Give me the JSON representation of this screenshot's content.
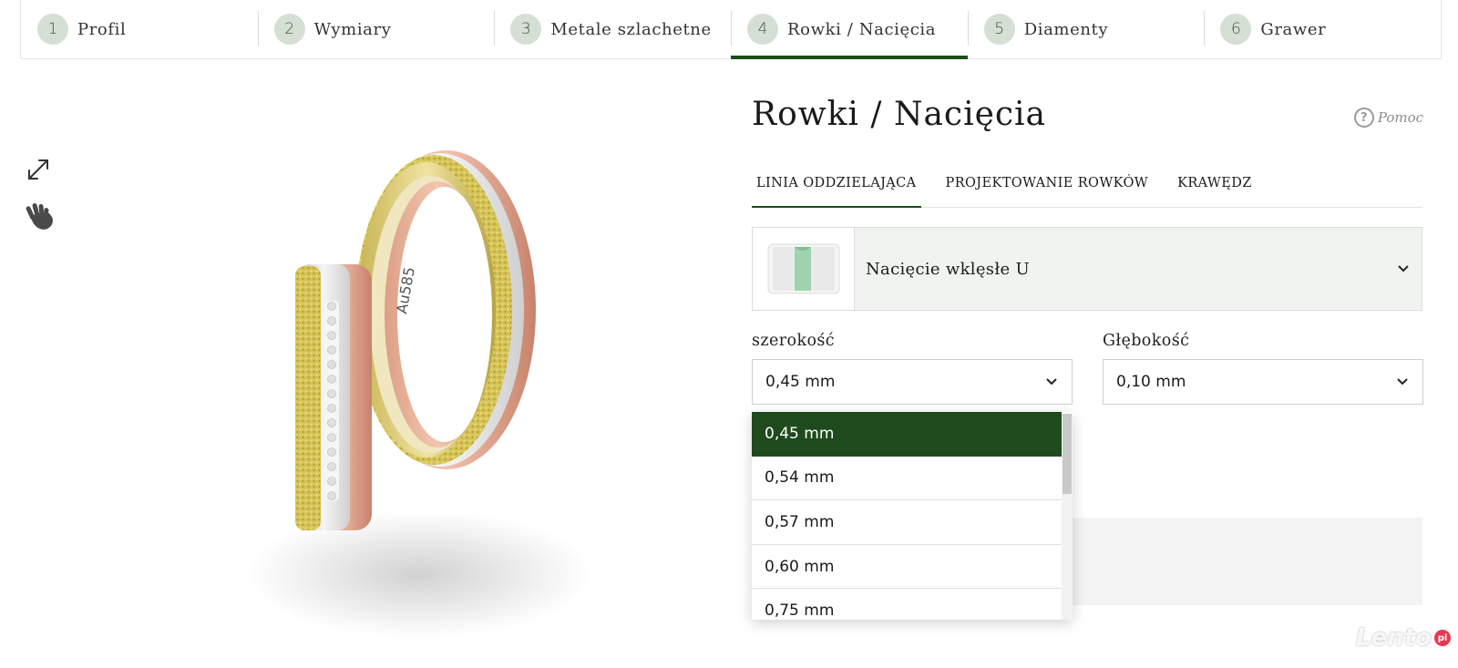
{
  "steps": [
    {
      "num": "1",
      "label": "Profil"
    },
    {
      "num": "2",
      "label": "Wymiary"
    },
    {
      "num": "3",
      "label": "Metale szlachetne"
    },
    {
      "num": "4",
      "label": "Rowki / Nacięcia"
    },
    {
      "num": "5",
      "label": "Diamenty"
    },
    {
      "num": "6",
      "label": "Grawer"
    }
  ],
  "active_step": "4",
  "tools": {
    "expand_icon": "expand-icon",
    "hand_icon": "hand-drag-icon"
  },
  "preview": {
    "engraving": "Au585"
  },
  "panel": {
    "title": "Rowki / Nacięcia",
    "help_label": "Pomoc",
    "help_glyph": "?",
    "subtabs": [
      "LINIA ODDZIELAJĄCA",
      "PROJEKTOWANIE ROWKÓW",
      "KRAWĘDZ"
    ],
    "active_subtab": "LINIA ODDZIELAJĄCA",
    "cut_type": "Nacięcie wklęsłe U",
    "width_label": "szerokość",
    "width_value": "0,45 mm",
    "depth_label": "Głębokość",
    "depth_value": "0,10 mm"
  },
  "width_options": [
    "0,45 mm",
    "0,54 mm",
    "0,57 mm",
    "0,60 mm",
    "0,75 mm"
  ],
  "width_selected": "0,45 mm",
  "watermark": {
    "text": "Lento",
    "badge": "pl"
  },
  "colors": {
    "accent": "#1b4d1b",
    "step_circle": "#d3e0d3",
    "selected_option": "#1e4a1e",
    "groove": "#9fd3b0"
  }
}
